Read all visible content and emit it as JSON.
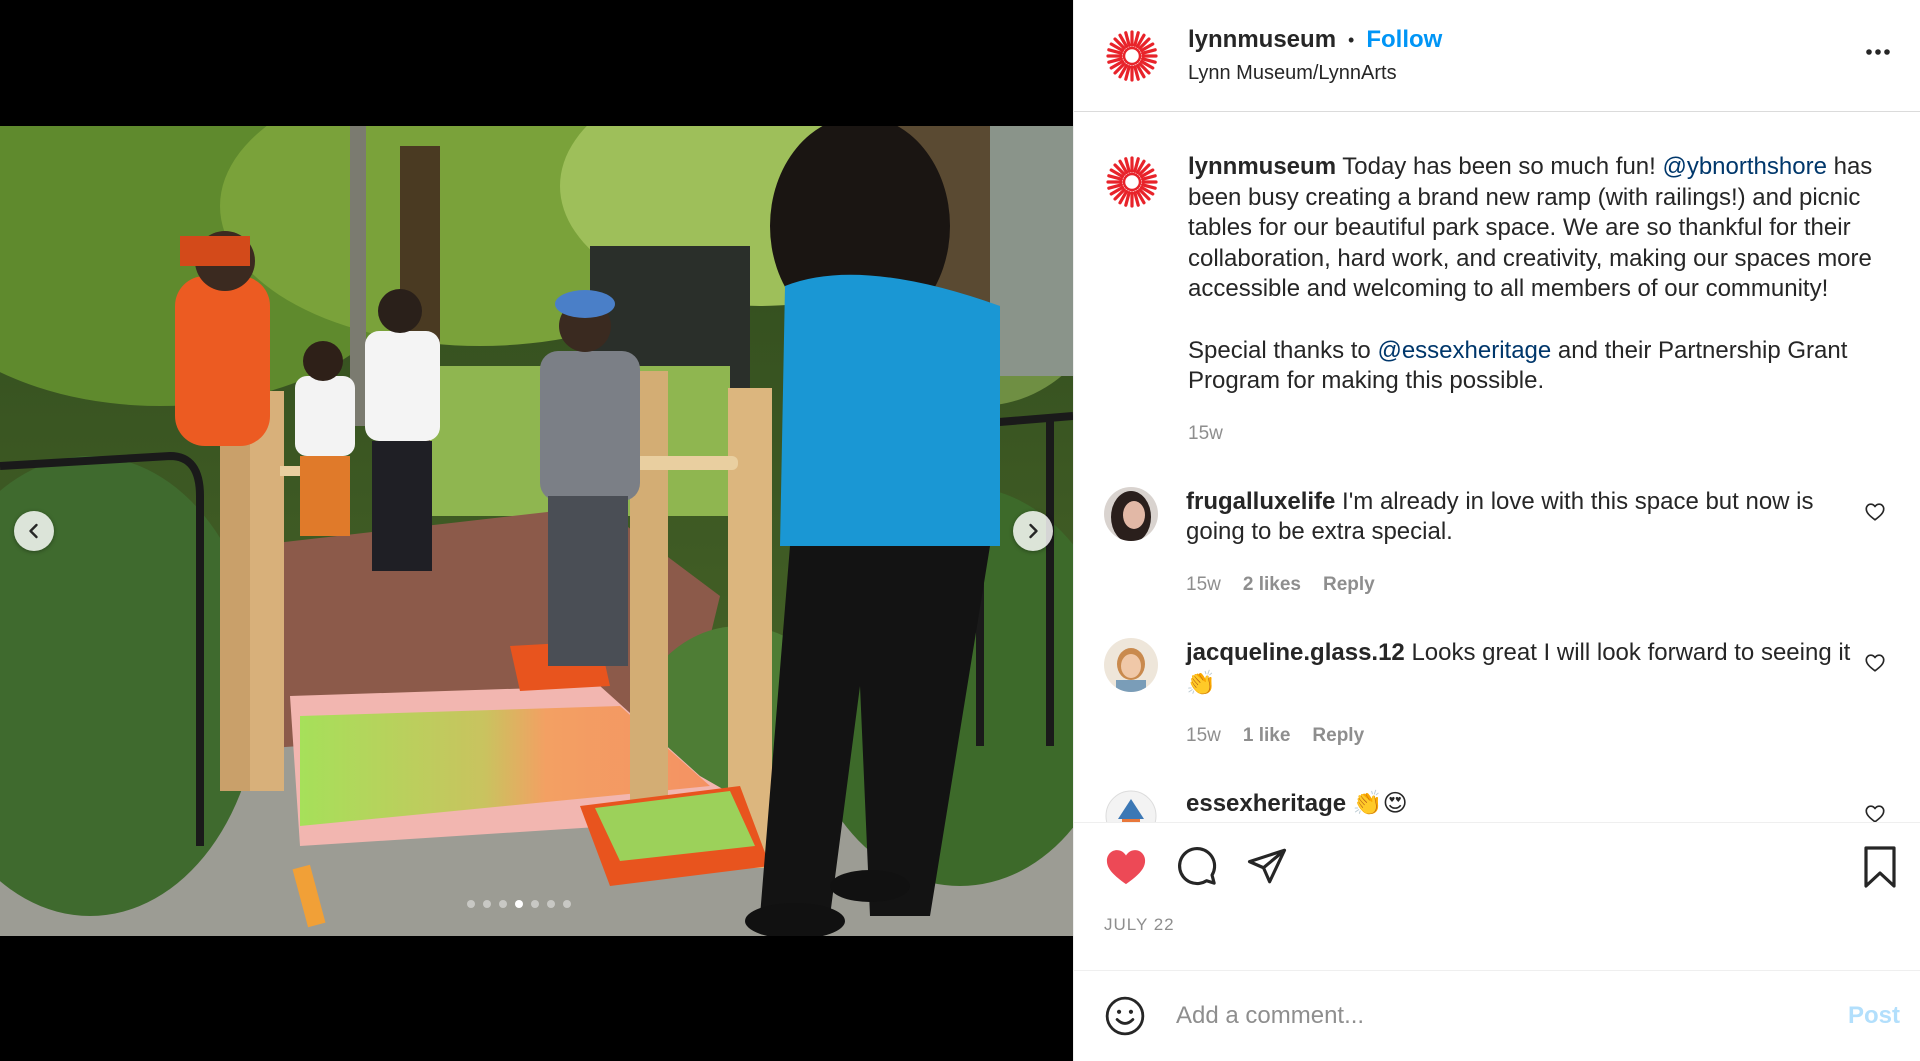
{
  "colors": {
    "accent": "#0095f6",
    "like": "#ed4956",
    "mention": "#00376b",
    "muted": "#8e8e8e",
    "logo": "#e8232a"
  },
  "carousel": {
    "slide_count": 7,
    "active_index": 3
  },
  "header": {
    "username": "lynnmuseum",
    "bullet": "•",
    "follow": "Follow",
    "location": "Lynn Museum/LynnArts",
    "more_icon": "more-horizontal-icon"
  },
  "caption": {
    "username": "lynnmuseum",
    "text_1": "Today has been so much fun! ",
    "mention_1": "@ybnorthshore",
    "text_2": " has been busy creating a brand new ramp (with railings!) and picnic tables for our beautiful park space. We are so thankful for their collaboration, hard work, and creativity, making our spaces more accessible and welcoming to all members of our community!",
    "text_3": "Special thanks to ",
    "mention_2": "@essexheritage",
    "text_4": " and their Partnership Grant Program for making this possible.",
    "time": "15w"
  },
  "comments": [
    {
      "username": "frugalluxelife",
      "text": "I'm already in love with this space but now is going to be extra special.",
      "time": "15w",
      "likes": "2 likes",
      "reply": "Reply"
    },
    {
      "username": "jacqueline.glass.12",
      "text": "Looks great I will look forward to seeing it👏",
      "time": "15w",
      "likes": "1 like",
      "reply": "Reply"
    },
    {
      "username": "essexheritage",
      "text": "👏😍"
    }
  ],
  "actions": {
    "liked": true,
    "date": "JULY 22"
  },
  "add_comment": {
    "placeholder": "Add a comment...",
    "post": "Post"
  }
}
